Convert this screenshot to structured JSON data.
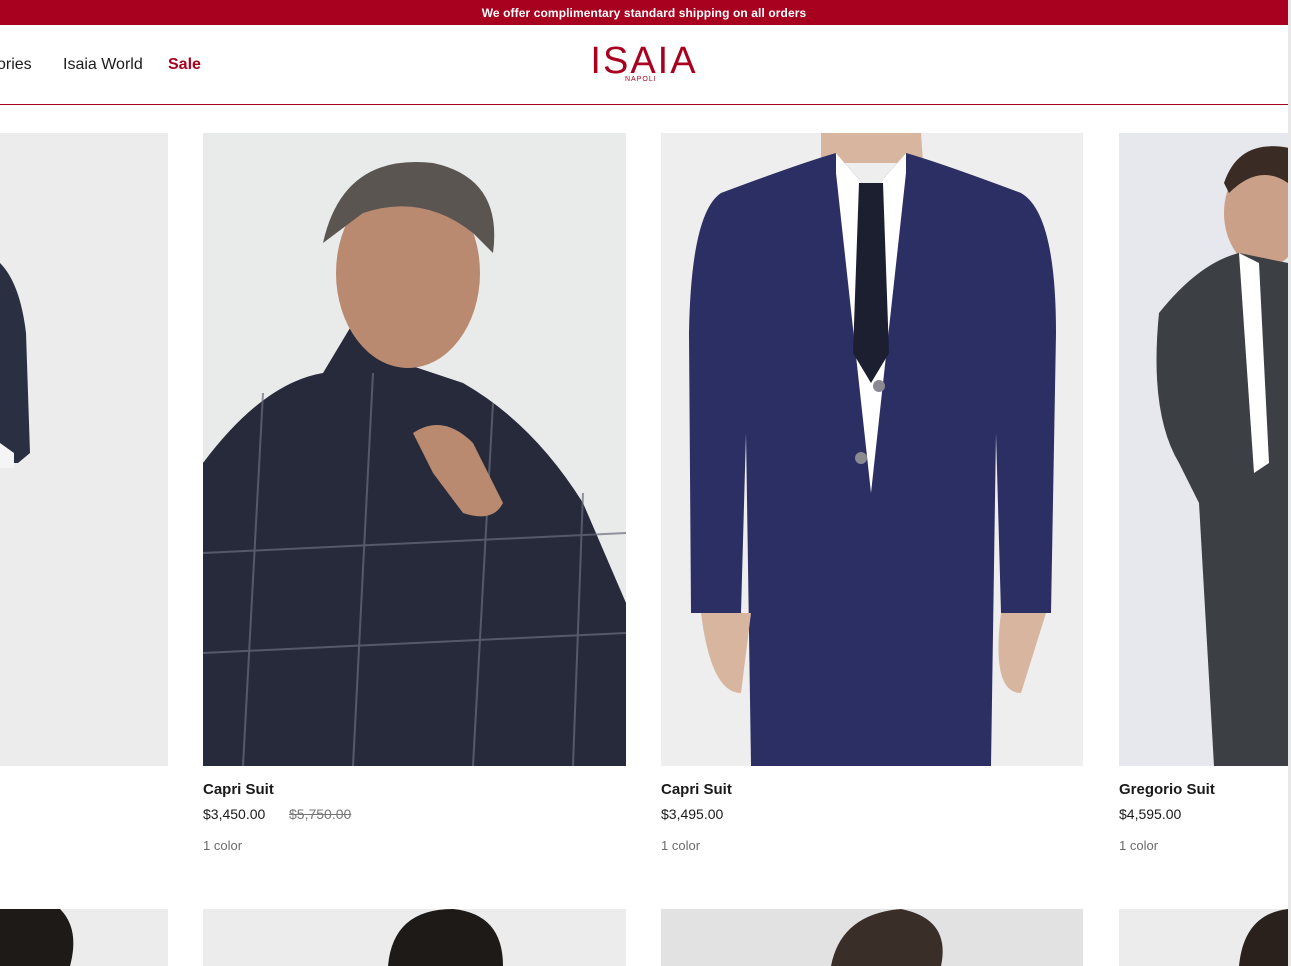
{
  "promo": {
    "text": "We offer complimentary standard shipping on all orders"
  },
  "nav": {
    "items": [
      {
        "label": "ories"
      },
      {
        "label": "Isaia World"
      },
      {
        "label": "Sale"
      }
    ]
  },
  "logo": {
    "word": "ISAIA",
    "sub": "NAPOLI"
  },
  "colors": {
    "brand": "#a8001f"
  },
  "products": [
    {
      "name": "Capri Suit",
      "price": "$3,450.00",
      "old_price": "$5,750.00",
      "colors": "1 color"
    },
    {
      "name": "Capri Suit",
      "price": "$3,495.00",
      "colors": "1 color"
    },
    {
      "name": "Gregorio Suit",
      "price": "$4,595.00",
      "colors": "1 color"
    }
  ]
}
